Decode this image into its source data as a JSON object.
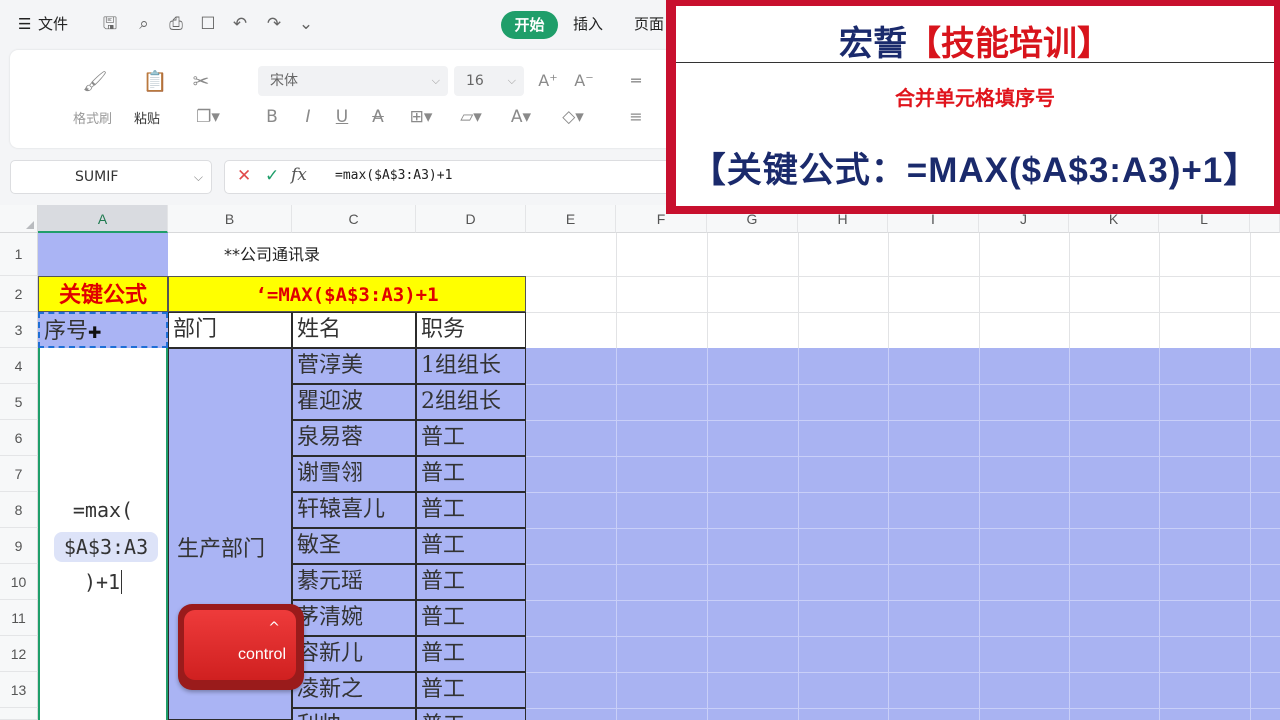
{
  "menubar": {
    "menu_icon": "☰",
    "file_label": "文件",
    "tabs": [
      "开始",
      "插入",
      "页面"
    ]
  },
  "ribbon": {
    "format_painter": "格式刷",
    "paste": "粘贴",
    "font_name": "宋体",
    "font_size": "16",
    "bold": "B",
    "italic": "I",
    "underline": "U",
    "strike": "A"
  },
  "formula_bar": {
    "name_box": "SUMIF",
    "fx": "fx",
    "formula": "=max($A$3:A3)+1"
  },
  "columns": [
    "A",
    "B",
    "C",
    "D",
    "E",
    "F",
    "G",
    "H",
    "I",
    "J",
    "K",
    "L"
  ],
  "rows": [
    "1",
    "2",
    "3",
    "4",
    "5",
    "6",
    "7",
    "8",
    "9",
    "10",
    "11",
    "12",
    "13"
  ],
  "sheet": {
    "title": "**公司通讯录",
    "key_formula_label": "关键公式",
    "key_formula": "‘=MAX($A$3:A3)+1",
    "headers": {
      "seq": "序号",
      "dept": "部门",
      "name": "姓名",
      "position": "职务"
    },
    "department": "生产部门",
    "editing_formula": {
      "line1": "=max(",
      "line2": "$A$3:A3",
      "line3": ")+1"
    },
    "employees": [
      {
        "name": "菅淳美",
        "position": "1组组长"
      },
      {
        "name": "瞿迎波",
        "position": "2组组长"
      },
      {
        "name": "泉易蓉",
        "position": "普工"
      },
      {
        "name": "谢雪翎",
        "position": "普工"
      },
      {
        "name": "轩辕喜儿",
        "position": "普工"
      },
      {
        "name": "敏圣",
        "position": "普工"
      },
      {
        "name": "綦元瑶",
        "position": "普工"
      },
      {
        "name": "茅清婉",
        "position": "普工"
      },
      {
        "name": "容新儿",
        "position": "普工"
      },
      {
        "name": "凌新之",
        "position": "普工"
      },
      {
        "name": "利帅",
        "position": "普工"
      }
    ]
  },
  "overlay": {
    "brand": "宏誓",
    "brand_suffix": "【技能培训】",
    "subtitle": "合并单元格填序号",
    "formula": "【关键公式：=MAX($A$3:A3)+1】"
  },
  "keycap": {
    "label": "control",
    "arrow": "^"
  }
}
